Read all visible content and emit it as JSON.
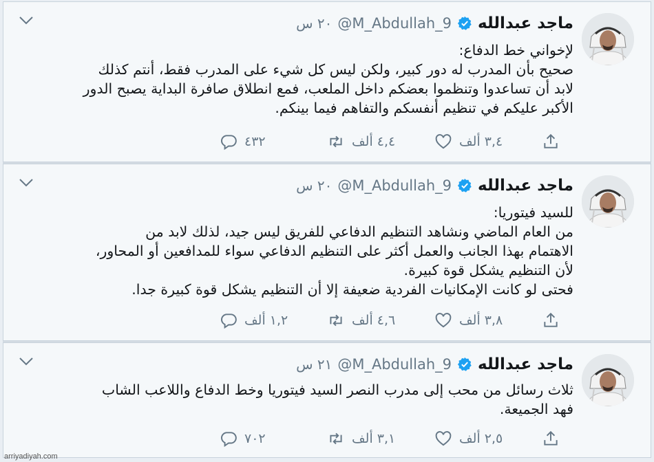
{
  "tweets": [
    {
      "author": "ماجد عبدالله",
      "handle": "@M_Abdullah_9",
      "time": "٢٠ س",
      "lines": [
        "لإخواني خط الدفاع:",
        "صحيح بأن المدرب له دور كبير، ولكن ليس كل شيء على المدرب فقط، أنتم كذلك",
        "لابد أن تساعدوا وتنظموا بعضكم داخل الملعب، فمع انطلاق صافرة البداية يصبح الدور",
        "الأكبر عليكم في تنظيم أنفسكم والتفاهم فيما بينكم."
      ],
      "replies": "٤٣٢",
      "retweets": "٤,٤ ألف",
      "likes": "٣,٤ ألف"
    },
    {
      "author": "ماجد عبدالله",
      "handle": "@M_Abdullah_9",
      "time": "٢٠ س",
      "lines": [
        "للسيد فيتوريا:",
        "من العام الماضي ونشاهد التنظيم الدفاعي للفريق ليس جيد، لذلك لابد من",
        "الاهتمام بهذا الجانب والعمل أكثر على التنظيم الدفاعي سواء للمدافعين أو المحاور،",
        "لأن التنظيم يشكل قوة كبيرة.",
        "فحتى لو كانت الإمكانيات الفردية ضعيفة إلا أن التنظيم يشكل قوة كبيرة جدا."
      ],
      "replies": "١,٢ ألف",
      "retweets": "٤,٦ ألف",
      "likes": "٣,٨ ألف"
    },
    {
      "author": "ماجد عبدالله",
      "handle": "@M_Abdullah_9",
      "time": "٢١ س",
      "lines": [
        "ثلاث رسائل من محب إلى مدرب النصر السيد فيتوريا وخط الدفاع واللاعب الشاب",
        "فهد الجميعة."
      ],
      "replies": "٧٠٢",
      "retweets": "٣,١ ألف",
      "likes": "٢,٥ ألف"
    }
  ],
  "icons": {
    "avatar": "avatar-photo",
    "verified": "verified-badge-icon",
    "menu": "chevron-down-icon",
    "reply": "reply-icon",
    "retweet": "retweet-icon",
    "like": "heart-icon",
    "share": "share-icon"
  },
  "colors": {
    "verified": "#1da1f2",
    "icon_gray": "#657786",
    "background": "#f5f8fa"
  },
  "watermark": "arriyadiyah.com"
}
